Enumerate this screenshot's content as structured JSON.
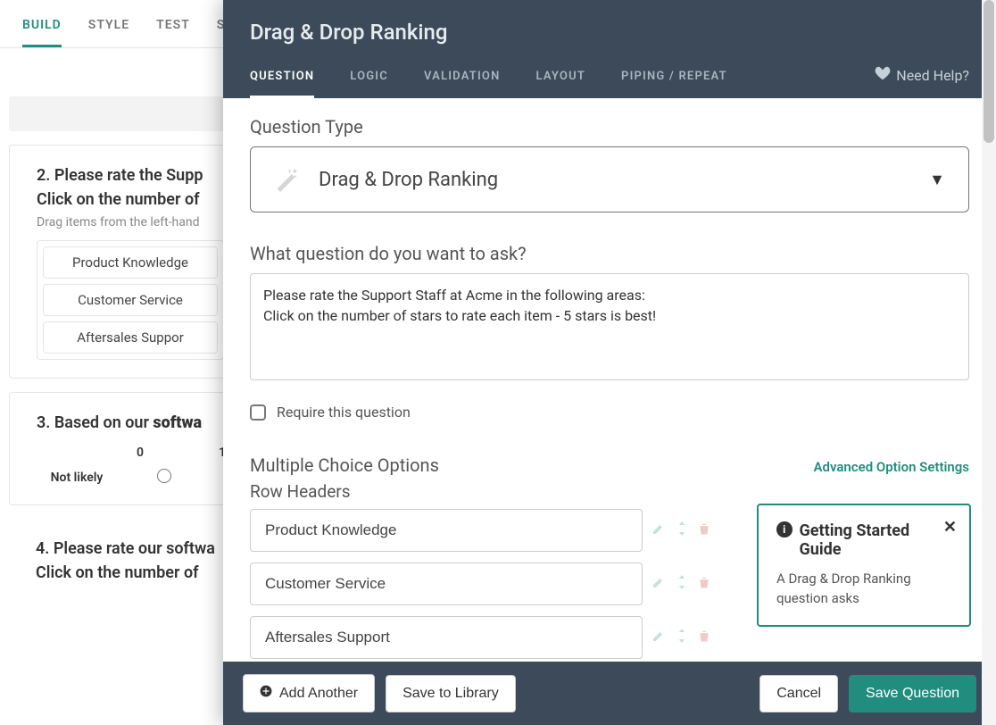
{
  "bgTabs": [
    "BUILD",
    "STYLE",
    "TEST",
    "S"
  ],
  "bgLeft1": "Left",
  "bgLeft2": "Left",
  "bgQ2": {
    "title": "2. Please rate the Supp",
    "sub1": "Click on the number of",
    "hint": "Drag items from the left-hand",
    "options": [
      "Product Knowledge",
      "Customer Service",
      "Aftersales Suppor"
    ]
  },
  "bgQ3": {
    "title_pre": "3. Based on our ",
    "title_bold": "softwa",
    "scale": [
      "0",
      "1"
    ],
    "leftLabel": "Not likely"
  },
  "bgQ4": {
    "line1": "4. Please rate our softwa",
    "line2": "Click on the number of"
  },
  "modal": {
    "title": "Drag & Drop Ranking",
    "tabs": [
      "QUESTION",
      "LOGIC",
      "VALIDATION",
      "LAYOUT",
      "PIPING / REPEAT"
    ],
    "help": "Need Help?",
    "qtypeLabel": "Question Type",
    "qtypeValue": "Drag & Drop Ranking",
    "askLabel": "What question do you want to ask?",
    "askValue": "Please rate the Support Staff at Acme in the following areas:\nClick on the number of stars to rate each item - 5 stars is best!",
    "require": "Require this question",
    "mcoLabel": "Multiple Choice Options",
    "advanced": "Advanced Option Settings",
    "rowHeadersLabel": "Row Headers",
    "rowHeaders": [
      "Product Knowledge",
      "Customer Service",
      "Aftersales Support"
    ],
    "guide": {
      "title": "Getting Started Guide",
      "body": "A Drag & Drop Ranking question asks"
    },
    "footer": {
      "addAnother": "Add Another",
      "saveLib": "Save to Library",
      "cancel": "Cancel",
      "save": "Save Question"
    }
  }
}
